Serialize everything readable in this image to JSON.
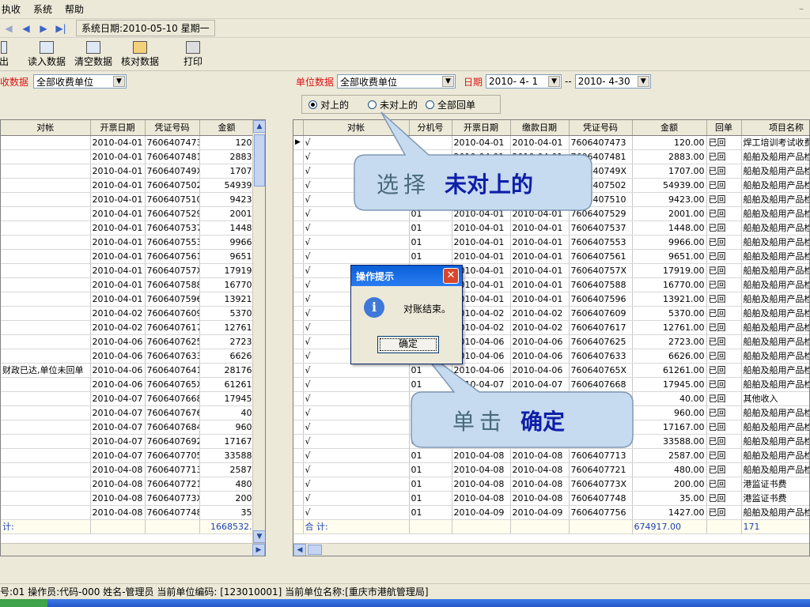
{
  "menu": {
    "items": [
      "执收",
      "系统",
      "帮助"
    ]
  },
  "nav": {
    "system_date": "系统日期:2010-05-10 星期一"
  },
  "toolbar": {
    "items": [
      "出",
      "读入数据",
      "清空数据",
      "核对数据",
      "打印"
    ]
  },
  "left_filter": {
    "label": "收数据",
    "unit_value": "全部收费单位"
  },
  "right_filter": {
    "unit_label": "单位数据",
    "unit_value": "全部收费单位",
    "date_label": "日期",
    "date_from": "2010- 4- 1",
    "date_sep": "--",
    "date_to": "2010- 4-30"
  },
  "radio": {
    "options": [
      "对上的",
      "未对上的",
      "全部回单"
    ],
    "selected": 0
  },
  "left_grid": {
    "columns": [
      "对帐",
      "开票日期",
      "凭证号码",
      "金额"
    ],
    "rows": [
      [
        "",
        "2010-04-01",
        "7606407473",
        "120"
      ],
      [
        "",
        "2010-04-01",
        "7606407481",
        "2883"
      ],
      [
        "",
        "2010-04-01",
        "760640749X",
        "1707"
      ],
      [
        "",
        "2010-04-01",
        "7606407502",
        "54939"
      ],
      [
        "",
        "2010-04-01",
        "7606407510",
        "9423"
      ],
      [
        "",
        "2010-04-01",
        "7606407529",
        "2001"
      ],
      [
        "",
        "2010-04-01",
        "7606407537",
        "1448"
      ],
      [
        "",
        "2010-04-01",
        "7606407553",
        "9966"
      ],
      [
        "",
        "2010-04-01",
        "7606407561",
        "9651"
      ],
      [
        "",
        "2010-04-01",
        "760640757X",
        "17919"
      ],
      [
        "",
        "2010-04-01",
        "7606407588",
        "16770"
      ],
      [
        "",
        "2010-04-01",
        "7606407596",
        "13921"
      ],
      [
        "",
        "2010-04-02",
        "7606407609",
        "5370"
      ],
      [
        "",
        "2010-04-02",
        "7606407617",
        "12761"
      ],
      [
        "",
        "2010-04-06",
        "7606407625",
        "2723"
      ],
      [
        "",
        "2010-04-06",
        "7606407633",
        "6626"
      ],
      [
        "财政已达,单位未回单",
        "2010-04-06",
        "7606407641",
        "28176"
      ],
      [
        "",
        "2010-04-06",
        "760640765X",
        "61261"
      ],
      [
        "",
        "2010-04-07",
        "7606407668",
        "17945"
      ],
      [
        "",
        "2010-04-07",
        "7606407676",
        "40"
      ],
      [
        "",
        "2010-04-07",
        "7606407684",
        "960"
      ],
      [
        "",
        "2010-04-07",
        "7606407692",
        "17167"
      ],
      [
        "",
        "2010-04-07",
        "7606407705",
        "33588"
      ],
      [
        "",
        "2010-04-08",
        "7606407713",
        "2587"
      ],
      [
        "",
        "2010-04-08",
        "7606407721",
        "480"
      ],
      [
        "",
        "2010-04-08",
        "760640773X",
        "200"
      ],
      [
        "",
        "2010-04-08",
        "7606407748",
        "35"
      ]
    ],
    "total_label": "计:",
    "total_value": "1668532."
  },
  "right_grid": {
    "columns": [
      "对帐",
      "分机号",
      "开票日期",
      "缴款日期",
      "凭证号码",
      "金额",
      "回单",
      "项目名称"
    ],
    "rows": [
      [
        "√",
        "",
        "2010-04-01",
        "2010-04-01",
        "7606407473",
        "120.00",
        "已回",
        "焊工培训考试收费"
      ],
      [
        "√",
        "",
        "2010-04-01",
        "2010-04-01",
        "7606407481",
        "2883.00",
        "已回",
        "船舶及船用产品检验"
      ],
      [
        "√",
        "",
        "2010-04-01",
        "2010-04-01",
        "760640749X",
        "1707.00",
        "已回",
        "船舶及船用产品检验"
      ],
      [
        "√",
        "",
        "2010-04-01",
        "2010-04-01",
        "7606407502",
        "54939.00",
        "已回",
        "船舶及船用产品检验"
      ],
      [
        "√",
        "",
        "2010-04-01",
        "2010-04-01",
        "7606407510",
        "9423.00",
        "已回",
        "船舶及船用产品检验"
      ],
      [
        "√",
        "01",
        "2010-04-01",
        "2010-04-01",
        "7606407529",
        "2001.00",
        "已回",
        "船舶及船用产品检验"
      ],
      [
        "√",
        "01",
        "2010-04-01",
        "2010-04-01",
        "7606407537",
        "1448.00",
        "已回",
        "船舶及船用产品检验"
      ],
      [
        "√",
        "01",
        "2010-04-01",
        "2010-04-01",
        "7606407553",
        "9966.00",
        "已回",
        "船舶及船用产品检验"
      ],
      [
        "√",
        "01",
        "2010-04-01",
        "2010-04-01",
        "7606407561",
        "9651.00",
        "已回",
        "船舶及船用产品检验"
      ],
      [
        "√",
        "",
        "2010-04-01",
        "2010-04-01",
        "760640757X",
        "17919.00",
        "已回",
        "船舶及船用产品检验"
      ],
      [
        "√",
        "",
        "2010-04-01",
        "2010-04-01",
        "7606407588",
        "16770.00",
        "已回",
        "船舶及船用产品检验"
      ],
      [
        "√",
        "",
        "2010-04-01",
        "2010-04-01",
        "7606407596",
        "13921.00",
        "已回",
        "船舶及船用产品检验"
      ],
      [
        "√",
        "",
        "2010-04-02",
        "2010-04-02",
        "7606407609",
        "5370.00",
        "已回",
        "船舶及船用产品检验"
      ],
      [
        "√",
        "",
        "2010-04-02",
        "2010-04-02",
        "7606407617",
        "12761.00",
        "已回",
        "船舶及船用产品检验"
      ],
      [
        "√",
        "",
        "2010-04-06",
        "2010-04-06",
        "7606407625",
        "2723.00",
        "已回",
        "船舶及船用产品检验"
      ],
      [
        "√",
        "",
        "2010-04-06",
        "2010-04-06",
        "7606407633",
        "6626.00",
        "已回",
        "船舶及船用产品检验"
      ],
      [
        "√",
        "01",
        "2010-04-06",
        "2010-04-06",
        "760640765X",
        "61261.00",
        "已回",
        "船舶及船用产品检验"
      ],
      [
        "√",
        "01",
        "2010-04-07",
        "2010-04-07",
        "7606407668",
        "17945.00",
        "已回",
        "船舶及船用产品检验"
      ],
      [
        "√",
        "",
        "",
        "",
        "",
        "40.00",
        "已回",
        "其他收入"
      ],
      [
        "√",
        "",
        "",
        "",
        "",
        "960.00",
        "已回",
        "船舶及船用产品检验"
      ],
      [
        "√",
        "",
        "",
        "",
        "",
        "17167.00",
        "已回",
        "船舶及船用产品检验"
      ],
      [
        "√",
        "01",
        "",
        "",
        "",
        "33588.00",
        "已回",
        "船舶及船用产品检验"
      ],
      [
        "√",
        "01",
        "2010-04-08",
        "2010-04-08",
        "7606407713",
        "2587.00",
        "已回",
        "船舶及船用产品检验"
      ],
      [
        "√",
        "01",
        "2010-04-08",
        "2010-04-08",
        "7606407721",
        "480.00",
        "已回",
        "船舶及船用产品检验"
      ],
      [
        "√",
        "01",
        "2010-04-08",
        "2010-04-08",
        "760640773X",
        "200.00",
        "已回",
        "港监证书费"
      ],
      [
        "√",
        "01",
        "2010-04-08",
        "2010-04-08",
        "7606407748",
        "35.00",
        "已回",
        "港监证书费"
      ],
      [
        "√",
        "01",
        "2010-04-09",
        "2010-04-09",
        "7606407756",
        "1427.00",
        "已回",
        "船舶及船用产品检验"
      ]
    ],
    "total_label": "合 计:",
    "total_value": "674917.00",
    "total_count": "171"
  },
  "dialog": {
    "title": "操作提示",
    "message": "对账结束。",
    "ok_label": "确定",
    "close_glyph": "✕",
    "icon_glyph": "i"
  },
  "callouts": {
    "top_gray": "选择",
    "top_blue": "未对上的",
    "bottom_gray": "单击",
    "bottom_blue": "确定"
  },
  "status": {
    "text": "号:01 操作员:代码-000 姓名-管理员 当前单位编码: [123010001] 当前单位名称:[重庆市港航管理局]"
  }
}
